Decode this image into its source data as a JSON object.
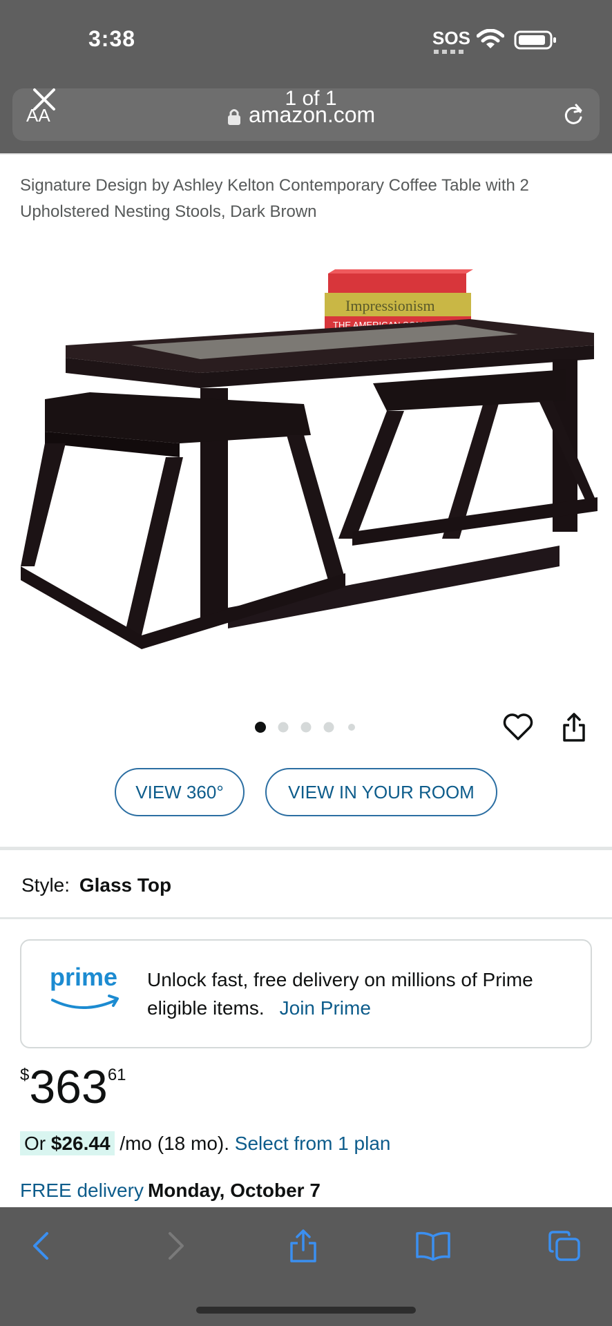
{
  "status_bar": {
    "time": "3:38",
    "carrier": "SOS"
  },
  "browser": {
    "close_label": "✕",
    "text_size_label": "AA",
    "page_count": "1 of 1",
    "domain": "amazon.com"
  },
  "product": {
    "title": "Signature Design by Ashley Kelton Contemporary Coffee Table with 2 Upholstered Nesting Stools, Dark Brown",
    "image_books": {
      "book1": "Impressionism",
      "book2": "THE AMERICAN SONGBOOK"
    },
    "carousel": {
      "total_images": 5,
      "active_index": 0
    },
    "buttons": {
      "view_360": "VIEW 360°",
      "view_in_room": "VIEW IN YOUR ROOM"
    },
    "style": {
      "label": "Style:",
      "value": "Glass Top"
    }
  },
  "prime": {
    "logo_word": "prime",
    "text": "Unlock fast, free delivery on millions of Prime eligible items.",
    "join_label": "Join Prime"
  },
  "price": {
    "symbol": "$",
    "whole": "363",
    "fraction": "61"
  },
  "financing": {
    "prefix": "Or",
    "amount": "$26.44",
    "term": "/mo (18 mo).",
    "select_plan": "Select from 1 plan"
  },
  "delivery": {
    "free_label": "FREE delivery",
    "date": "Monday, October 7"
  },
  "colors": {
    "link": "#0d5c8b",
    "prime_blue": "#1c8bd1",
    "toolbar_icon": "#3b8ff0",
    "financing_highlight": "#d9f5f0"
  },
  "icons": {
    "wishlist": "heart-icon",
    "share": "share-icon",
    "back": "chevron-left-icon",
    "forward": "chevron-right-icon",
    "toolbar_share": "share-icon",
    "bookmarks": "book-icon",
    "tabs": "tabs-icon"
  }
}
